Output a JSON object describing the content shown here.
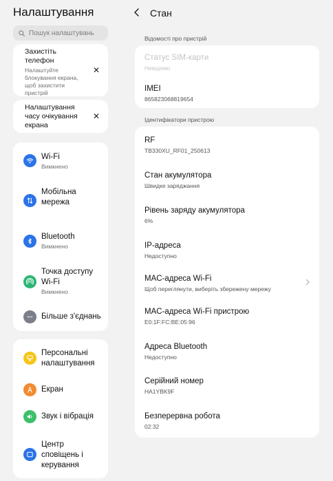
{
  "left": {
    "title": "Налаштування",
    "search_placeholder": "Пошук налаштувань",
    "tips": [
      {
        "title": "Захистіть телефон",
        "subtitle": "Налаштуйте блокування екрана, щоб захистити пристрій",
        "close": "✕"
      },
      {
        "title": "Налаштування часу очікування екрана",
        "close": "✕"
      }
    ],
    "connectivity": [
      {
        "label": "Wi-Fi",
        "sub": "Вимкнено",
        "icon": "wifi-icon",
        "color": "#2a73e8"
      },
      {
        "label": "Мобільна мережа",
        "icon": "mobile-network-icon",
        "color": "#2a73e8"
      },
      {
        "label": "Bluetooth",
        "sub": "Вимкнено",
        "icon": "bluetooth-icon",
        "color": "#2a73e8"
      },
      {
        "label": "Точка доступу Wi-Fi",
        "sub": "Вимкнено",
        "icon": "hotspot-icon",
        "color": "#2bb673"
      },
      {
        "label": "Більше з'єднань",
        "icon": "more-icon",
        "color": "#7a7f8a"
      }
    ],
    "personal": [
      {
        "label": "Персональні налаштування",
        "icon": "personalization-icon",
        "color": "#f5c518"
      },
      {
        "label": "Екран",
        "icon": "display-icon",
        "color": "#f28b30"
      },
      {
        "label": "Звук і вібрація",
        "icon": "sound-icon",
        "color": "#3cc06a"
      },
      {
        "label": "Центр сповіщень і керування",
        "icon": "notification-center-icon",
        "color": "#2a73e8"
      }
    ]
  },
  "right": {
    "title": "Стан",
    "section1": "Відомості про пристрій",
    "device_info": [
      {
        "label": "Статус SIM-карти",
        "value": "Невідомо",
        "disabled": true
      },
      {
        "label": "IMEI",
        "value": "865823068819654"
      }
    ],
    "section2": "Ідентифікатори пристрою",
    "identifiers": [
      {
        "label": "RF",
        "value": "TB330XU_RF01_250613"
      },
      {
        "label": "Стан акумулятора",
        "value": "Швидке заряджання"
      },
      {
        "label": "Рівень заряду акумулятора",
        "value": "6%"
      },
      {
        "label": "IP-адреса",
        "value": "Недоступно"
      },
      {
        "label": "MAC-адреса Wi-Fi",
        "value": "Щоб переглянути, виберіть збережену мережу",
        "chevron": true
      },
      {
        "label": "MAC-адреса Wi-Fi пристрою",
        "value": "E0:1F:FC:BE:05:96"
      },
      {
        "label": "Адреса Bluetooth",
        "value": "Недоступно"
      },
      {
        "label": "Серійний номер",
        "value": "HA1YBK9F"
      },
      {
        "label": "Безперервна робота",
        "value": "02:32"
      }
    ]
  }
}
